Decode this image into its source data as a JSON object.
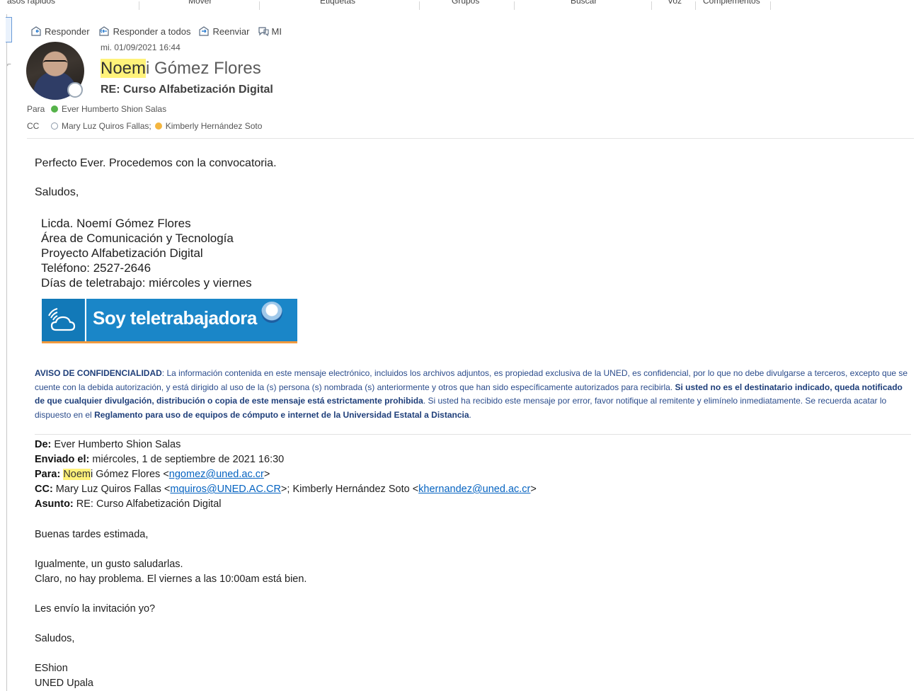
{
  "ribbon": {
    "groups": [
      "asos rápidos",
      "Mover",
      "Etiquetas",
      "Grupos",
      "Buscar",
      "Voz",
      "Complementos"
    ]
  },
  "actions": {
    "reply": "Responder",
    "reply_all": "Responder a todos",
    "forward": "Reenviar",
    "im": "MI"
  },
  "message": {
    "date": "mi. 01/09/2021 16:44",
    "sender_first_highlight": "Noem",
    "sender_rest": "i Gómez Flores",
    "subject": "RE: Curso Alfabetización Digital",
    "to_label": "Para",
    "to": "Ever Humberto Shion Salas",
    "cc_label": "CC",
    "cc_1": "Mary Luz Quiros Fallas;",
    "cc_2": "Kimberly Hernández Soto"
  },
  "body": {
    "line1": "Perfecto Ever.  Procedemos con la convocatoria.",
    "line2": "Saludos,",
    "signature": [
      "Licda. Noemí Gómez Flores",
      "Área de Comunicación y Tecnología",
      "Proyecto Alfabetización Digital",
      "Teléfono: 2527-2646",
      "Días de teletrabajo: miércoles y viernes"
    ],
    "banner_text": "Soy teletrabajadora"
  },
  "notice": {
    "label": "AVISO DE CONFIDENCIALIDAD",
    "text1": ": La información contenida en este mensaje electrónico, incluidos los archivos adjuntos, es propiedad exclusiva de la UNED, es confidencial, por lo que no debe divulgarse a terceros, excepto que se cuente con la debida autorización, y está dirigido al uso de la (s) persona (s) nombrada (s) anteriormente y otros que han sido específicamente autorizados para recibirla. ",
    "bold1": "Si usted no es el destinatario indicado, queda notificado de que cualquier divulgación, distribución o copia de este mensaje está estrictamente prohibida",
    "text2": ". Si usted ha recibido este mensaje por error, favor notifique al remitente y elimínelo inmediatamente. Se recuerda acatar lo dispuesto en el ",
    "bold2": "Reglamento para uso de equipos de cómputo e internet de la Universidad Estatal a Distancia",
    "text3": "."
  },
  "quoted": {
    "from_label": "De:",
    "from": " Ever Humberto Shion Salas",
    "sent_label": "Enviado el:",
    "sent": " miércoles, 1 de septiembre de 2021 16:30",
    "to_label": "Para:",
    "to_highlight": "Noem",
    "to_rest": "i Gómez Flores <",
    "to_email": "ngomez@uned.ac.cr",
    "to_end": ">",
    "cc_label": "CC:",
    "cc_1": " Mary Luz Quiros Fallas <",
    "cc_1_email": "mquiros@UNED.AC.CR",
    "cc_mid": ">; Kimberly Hernández Soto <",
    "cc_2_email": "khernandez@uned.ac.cr",
    "cc_end": ">",
    "subject_label": "Asunto:",
    "subject": " RE: Curso Alfabetización Digital",
    "greeting": "Buenas tardes estimada,",
    "line1": "Igualmente, un gusto saludarlas.",
    "line2": "Claro, no hay problema. El viernes a las 10:00am está bien.",
    "line3": "Les envío la invitación yo?",
    "closing": "Saludos,",
    "sig1": "EShion",
    "sig2": "UNED Upala"
  },
  "colors": {
    "highlight": "#fff27a",
    "link": "#0563c1",
    "notice_text": "#2b4c8c",
    "banner_blue": "#1a86c8",
    "banner_orange": "#f19a3e"
  }
}
